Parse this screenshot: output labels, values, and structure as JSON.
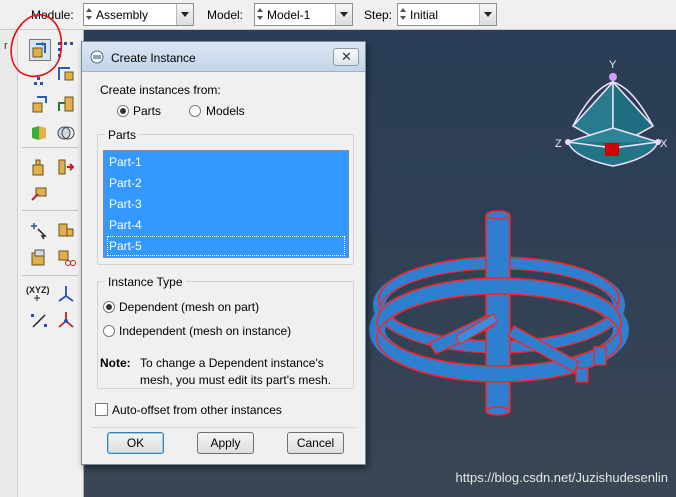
{
  "context_bar": {
    "module_label": "Module:",
    "module_value": "Assembly",
    "model_label": "Model:",
    "model_value": "Model-1",
    "step_label": "Step:",
    "step_value": "Initial"
  },
  "toolbox": {
    "side_tab_char": "r",
    "tools": [
      "create-instance-icon",
      "linear-pattern-icon",
      "translate-instance-icon",
      "rotate-instance-icon",
      "translate-to-icon",
      "constraint-icon",
      "merge-cut-icon",
      "boolean-icon",
      "parallel-face-icon",
      "face-to-face-icon",
      "edge-to-edge-icon",
      "coaxial-icon",
      "datum-csys-icon",
      "csys-icon",
      "query-icon",
      "replace-instance-icon",
      "display-options-icon",
      "cut-instance-icon",
      "datum-point-icon",
      "datum-axis-icon",
      "datum-plane-icon",
      "partition-icon"
    ],
    "csys_label": "(XYZ)"
  },
  "dialog": {
    "title": "Create Instance",
    "close_symbol": "✕",
    "create_from_label": "Create instances from:",
    "source_options": [
      {
        "label": "Parts",
        "selected": true
      },
      {
        "label": "Models",
        "selected": false
      }
    ],
    "parts_group_title": "Parts",
    "parts": [
      "Part-1",
      "Part-2",
      "Part-3",
      "Part-4",
      "Part-5"
    ],
    "instance_type_title": "Instance Type",
    "instance_types": [
      {
        "label": "Dependent (mesh on part)",
        "selected": true
      },
      {
        "label": "Independent (mesh on instance)",
        "selected": false
      }
    ],
    "note_label": "Note:",
    "note_text": "To change a Dependent instance's mesh, you must edit its part's mesh.",
    "auto_offset_label": "Auto-offset from other instances",
    "auto_offset_checked": false,
    "buttons": {
      "ok": "OK",
      "apply": "Apply",
      "cancel": "Cancel"
    }
  },
  "viewport": {
    "triad_labels": {
      "y": "Y",
      "z": "Z",
      "x": "X"
    },
    "watermark": "https://blog.csdn.net/Juzishudesenlin",
    "model_color": "#2e7fd0",
    "edge_color": "#ff1a1a"
  }
}
